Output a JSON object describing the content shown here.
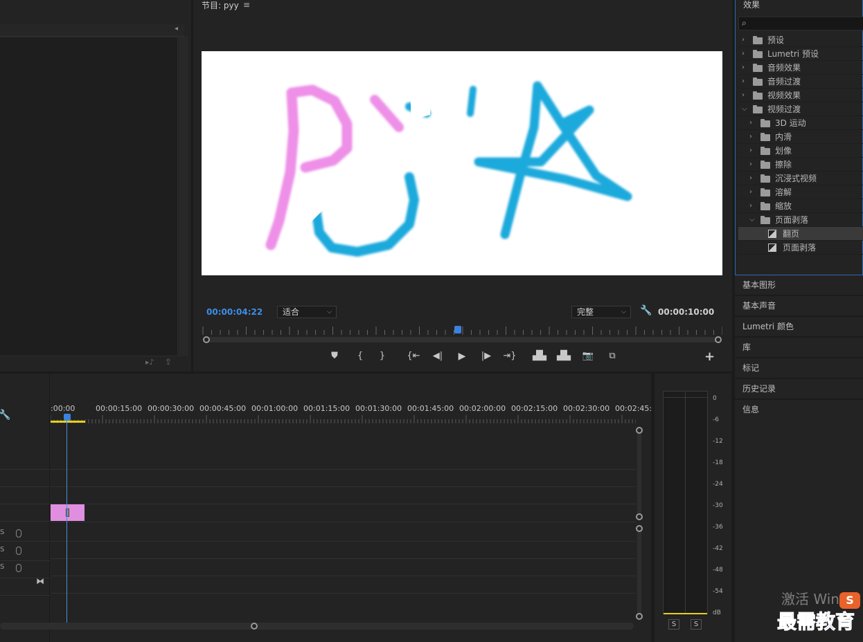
{
  "program": {
    "title": "节目: pyy",
    "menu_icon": "hamburger-icon",
    "timecode_current": "00:00:04:22",
    "zoom": "适合",
    "quality": "完整",
    "timecode_duration": "00:00:10:00",
    "playhead_fraction": 0.49,
    "add_label": "+"
  },
  "effects": {
    "title": "效果",
    "search_placeholder": "",
    "items": [
      {
        "label": "预设",
        "level": 0,
        "type": "preset",
        "expanded": false
      },
      {
        "label": "Lumetri 预设",
        "level": 0,
        "type": "preset",
        "expanded": false
      },
      {
        "label": "音频效果",
        "level": 0,
        "type": "folder",
        "expanded": false
      },
      {
        "label": "音频过渡",
        "level": 0,
        "type": "folder",
        "expanded": false
      },
      {
        "label": "视频效果",
        "level": 0,
        "type": "folder",
        "expanded": false
      },
      {
        "label": "视频过渡",
        "level": 0,
        "type": "folder",
        "expanded": true
      },
      {
        "label": "3D 运动",
        "level": 1,
        "type": "folder",
        "expanded": false
      },
      {
        "label": "内滑",
        "level": 1,
        "type": "folder",
        "expanded": false
      },
      {
        "label": "划像",
        "level": 1,
        "type": "folder",
        "expanded": false
      },
      {
        "label": "擦除",
        "level": 1,
        "type": "folder",
        "expanded": false
      },
      {
        "label": "沉浸式视频",
        "level": 1,
        "type": "folder",
        "expanded": false
      },
      {
        "label": "溶解",
        "level": 1,
        "type": "folder",
        "expanded": false
      },
      {
        "label": "缩放",
        "level": 1,
        "type": "folder",
        "expanded": false
      },
      {
        "label": "页面剥落",
        "level": 1,
        "type": "folder",
        "expanded": true
      },
      {
        "label": "翻页",
        "level": 2,
        "type": "effect",
        "selected": true
      },
      {
        "label": "页面剥落",
        "level": 2,
        "type": "effect",
        "selected": false
      }
    ]
  },
  "side_tabs": [
    "基本图形",
    "基本声音",
    "Lumetri 颜色",
    "库",
    "标记",
    "历史记录",
    "信息"
  ],
  "timeline": {
    "ruler_labels": [
      ":00:00",
      "00:00:15:00",
      "00:00:30:00",
      "00:00:45:00",
      "00:01:00:00",
      "00:01:15:00",
      "00:01:30:00",
      "00:01:45:00",
      "00:02:00:00",
      "00:02:15:00",
      "00:02:30:00",
      "00:02:45:"
    ],
    "audio_tracks": [
      {
        "label": "S"
      },
      {
        "label": "S"
      },
      {
        "label": "S"
      }
    ],
    "clip_color": "#e08fe0"
  },
  "meter": {
    "db_labels": [
      "0",
      "-6",
      "-12",
      "-18",
      "-24",
      "-30",
      "-36",
      "-42",
      "-48",
      "-54",
      "dB"
    ],
    "solo_labels": [
      "S",
      "S"
    ]
  },
  "watermark": {
    "line1": "激活 Wind",
    "logo": "最需教育",
    "badge": "S"
  },
  "colors": {
    "accent": "#3b82e0",
    "timecode": "#3d8ee8",
    "pink_stroke": "#ee8fe8",
    "blue_stroke": "#1fa9dc",
    "yellow": "#e7d11a"
  }
}
